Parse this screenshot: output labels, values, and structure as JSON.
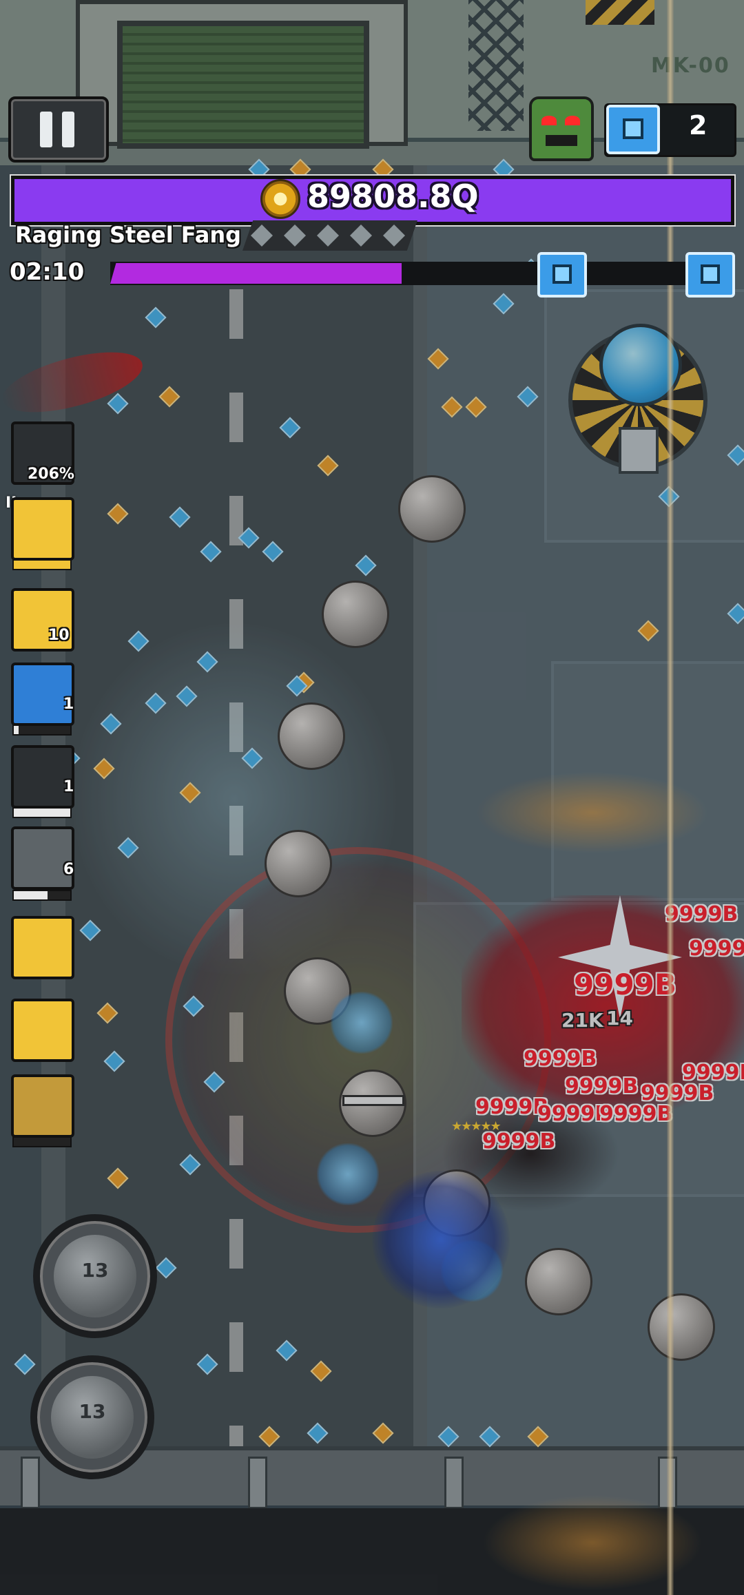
{
  "hud": {
    "boss_hp": "89808.8Q",
    "boss_name": "Raging Steel Fang",
    "timer": "02:10",
    "chest_count": "2",
    "stage_progress": 0.47,
    "boss_hp_fraction": 1.0,
    "wall_label": "MK-00"
  },
  "skills": [
    {
      "name": "speed-gauge",
      "label": "206%"
    },
    {
      "name": "burst",
      "label": "II",
      "progress": 1.0
    },
    {
      "name": "blood-drop",
      "label": "10"
    },
    {
      "name": "fire-orb",
      "label": "1",
      "progress": 0.08
    },
    {
      "name": "shield",
      "label": "1",
      "progress": 1.0
    },
    {
      "name": "blade",
      "label": "6",
      "progress": 0.6
    },
    {
      "name": "penguin-upgrade",
      "label": ""
    },
    {
      "name": "cat-pet",
      "label": ""
    },
    {
      "name": "potion-flask",
      "label": "",
      "progress": 0.0
    }
  ],
  "abilities": [
    {
      "name": "moon-ability",
      "cooldown": "13"
    },
    {
      "name": "dash-ability",
      "cooldown": "13"
    }
  ],
  "combat_text": {
    "big_damage": "9999B",
    "small_damage": "21K",
    "small_damage_2": "14",
    "stars": "★★★★★"
  },
  "colors": {
    "boss_bar": "#7c2fe0",
    "progress": "#b22ae0",
    "gem_blue": "#4db8f0",
    "gem_gold": "#f3a52f",
    "damage_red": "#ff2433"
  }
}
